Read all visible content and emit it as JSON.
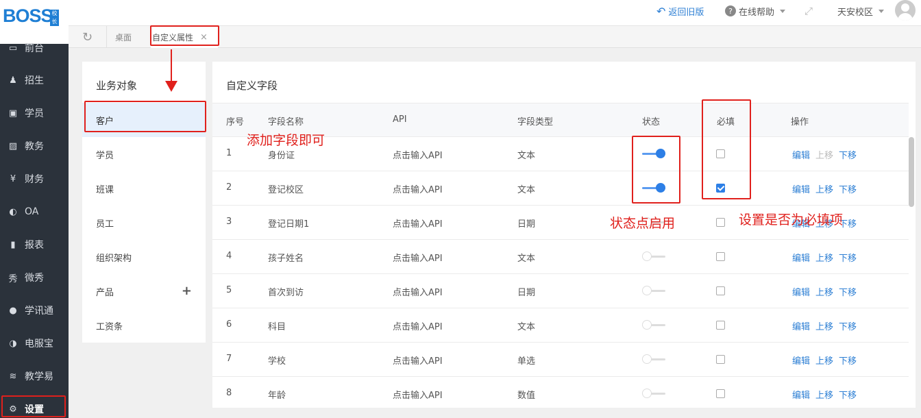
{
  "sidebar": {
    "logo_text": "BOSS",
    "logo_badge": "校长",
    "items": [
      {
        "label": "前台",
        "icon": "calendar-icon",
        "glyph": "▭"
      },
      {
        "label": "招生",
        "icon": "user-add-icon",
        "glyph": "♟"
      },
      {
        "label": "学员",
        "icon": "id-card-icon",
        "glyph": "▣"
      },
      {
        "label": "教务",
        "icon": "picture-icon",
        "glyph": "▨"
      },
      {
        "label": "财务",
        "icon": "yen-icon",
        "glyph": "¥"
      },
      {
        "label": "OA",
        "icon": "toggle-icon",
        "glyph": "◐"
      },
      {
        "label": "报表",
        "icon": "bar-chart-icon",
        "glyph": "▮"
      },
      {
        "label": "微秀",
        "icon": "xiu-icon",
        "glyph": "秀"
      },
      {
        "label": "学讯通",
        "icon": "location-icon",
        "glyph": "●"
      },
      {
        "label": "电服宝",
        "icon": "phone-icon",
        "glyph": "◑"
      },
      {
        "label": "教学易",
        "icon": "book-icon",
        "glyph": "≋"
      },
      {
        "label": "设置",
        "icon": "gear-icon",
        "glyph": "⚙"
      }
    ]
  },
  "topbar": {
    "back_old": "返回旧版",
    "help": "在线帮助",
    "campus": "天安校区"
  },
  "tabs": {
    "desktop": "桌面",
    "custom_attr": "自定义属性",
    "close": "×"
  },
  "objects": {
    "title": "业务对象",
    "items": [
      "客户",
      "学员",
      "班课",
      "员工",
      "组织架构",
      "产品",
      "工资条"
    ],
    "plus": "+"
  },
  "fields": {
    "title": "自定义字段",
    "headers": {
      "index": "序号",
      "name": "字段名称",
      "api": "API",
      "type": "字段类型",
      "status": "状态",
      "required": "必填",
      "ops": "操作"
    },
    "ops": {
      "edit": "编辑",
      "up": "上移",
      "down": "下移"
    },
    "rows": [
      {
        "index": "1",
        "name": "身份证",
        "api": "点击输入API",
        "type": "文本",
        "enabled": true,
        "required": false
      },
      {
        "index": "2",
        "name": "登记校区",
        "api": "点击输入API",
        "type": "文本",
        "enabled": true,
        "required": true
      },
      {
        "index": "3",
        "name": "登记日期1",
        "api": "点击输入API",
        "type": "日期",
        "enabled": false,
        "required": false
      },
      {
        "index": "4",
        "name": "孩子姓名",
        "api": "点击输入API",
        "type": "文本",
        "enabled": false,
        "required": false
      },
      {
        "index": "5",
        "name": "首次到访",
        "api": "点击输入API",
        "type": "日期",
        "enabled": false,
        "required": false
      },
      {
        "index": "6",
        "name": "科目",
        "api": "点击输入API",
        "type": "文本",
        "enabled": false,
        "required": false
      },
      {
        "index": "7",
        "name": "学校",
        "api": "点击输入API",
        "type": "单选",
        "enabled": false,
        "required": false
      },
      {
        "index": "8",
        "name": "年龄",
        "api": "点击输入API",
        "type": "数值",
        "enabled": false,
        "required": false
      }
    ]
  },
  "annotations": {
    "add_field": "添加字段即可",
    "status_enable": "状态点启用",
    "required_setting": "设置是否为必填项"
  },
  "colors": {
    "annotation": "#e0201c",
    "accent": "#2d7fe6",
    "sidebar": "#2b323b"
  }
}
